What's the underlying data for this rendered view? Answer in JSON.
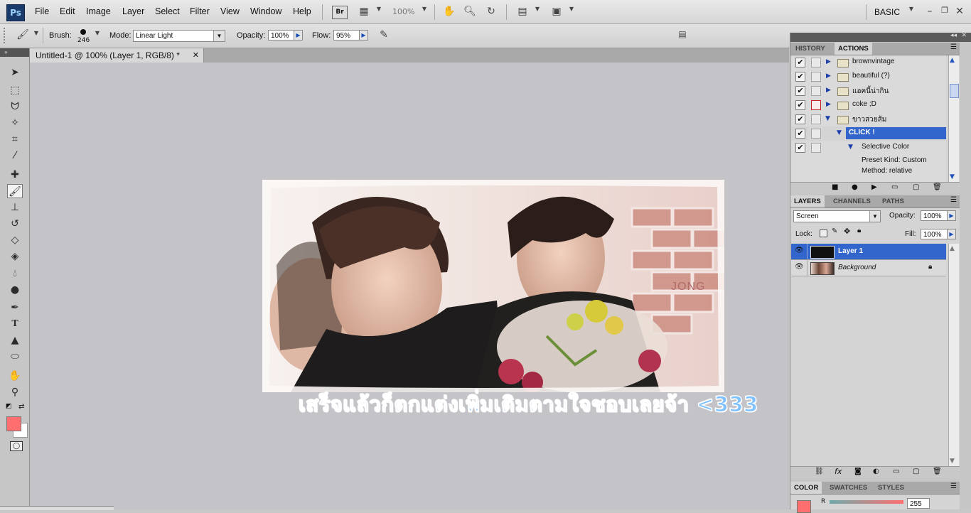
{
  "app": {
    "logo": "Ps"
  },
  "menu": [
    "File",
    "Edit",
    "Image",
    "Layer",
    "Select",
    "Filter",
    "View",
    "Window",
    "Help"
  ],
  "appbar": {
    "zoom": "100%",
    "workspace": "BASIC",
    "bridge_label": "Br"
  },
  "options": {
    "brush_label": "Brush:",
    "brush_size": "246",
    "mode_label": "Mode:",
    "mode_value": "Linear Light",
    "opacity_label": "Opacity:",
    "opacity_value": "100%",
    "flow_label": "Flow:",
    "flow_value": "95%"
  },
  "document": {
    "tab_title": "Untitled-1 @ 100% (Layer 1, RGB/8) *"
  },
  "canvas": {
    "caption": "เสร็จแล้วก็ตกแต่งเพิ่มเติมตามใจชอบเลยจ้า  <333",
    "watermark": "JONG"
  },
  "history_panel": {
    "tabs": [
      "HISTORY",
      "ACTIONS"
    ],
    "actions": [
      {
        "name": "brownvintage",
        "level": 0,
        "expanded": false,
        "dialog": false
      },
      {
        "name": "beautiful (?)",
        "level": 0,
        "expanded": false,
        "dialog": false
      },
      {
        "name": "แอคนี้น่ากิน",
        "level": 0,
        "expanded": false,
        "dialog": false
      },
      {
        "name": "coke ;D",
        "level": 0,
        "expanded": false,
        "dialog": true
      },
      {
        "name": "ขาวสวยส้ม",
        "level": 0,
        "expanded": true,
        "dialog": false
      },
      {
        "name": "CLICK !",
        "level": 1,
        "expanded": true,
        "dialog": false,
        "selected": true
      },
      {
        "name": "Selective Color",
        "level": 2,
        "expanded": true,
        "dialog": false
      },
      {
        "name": "Preset Kind: Custom",
        "level": 3
      },
      {
        "name": "Method: relative",
        "level": 3
      }
    ]
  },
  "layers_panel": {
    "tabs": [
      "LAYERS",
      "CHANNELS",
      "PATHS"
    ],
    "blend_mode": "Screen",
    "opacity_label": "Opacity:",
    "opacity_value": "100%",
    "lock_label": "Lock:",
    "fill_label": "Fill:",
    "fill_value": "100%",
    "layers": [
      {
        "name": "Layer 1",
        "selected": true,
        "locked": false
      },
      {
        "name": "Background",
        "selected": false,
        "locked": true
      }
    ]
  },
  "color_panel": {
    "tabs": [
      "COLOR",
      "SWATCHES",
      "STYLES"
    ],
    "channel_label": "R",
    "channel_value": "255"
  },
  "colors": {
    "accent": "#3b6fd1",
    "foreground": "#ff6f6f",
    "background": "#ffffff"
  }
}
